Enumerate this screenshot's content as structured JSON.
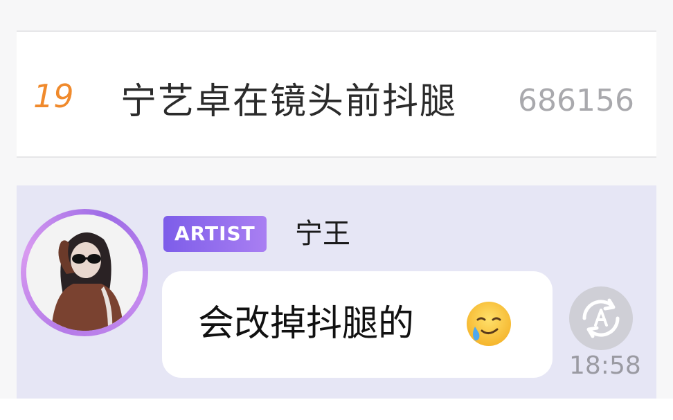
{
  "trending": {
    "rank": "19",
    "title": "宁艺卓在镜头前抖腿",
    "count": "686156"
  },
  "message": {
    "badge": "ARTIST",
    "sender": "宁王",
    "text": "会改掉抖腿的",
    "emoji_icon": "face-holding-back-tears-icon",
    "time": "18:58",
    "translate_icon": "translate-icon"
  },
  "colors": {
    "rank": "#f08a2c",
    "badge_start": "#7d5de9",
    "badge_end": "#a97ff2",
    "chat_background": "#e6e6f5",
    "avatar_ring": "#b57be8"
  }
}
